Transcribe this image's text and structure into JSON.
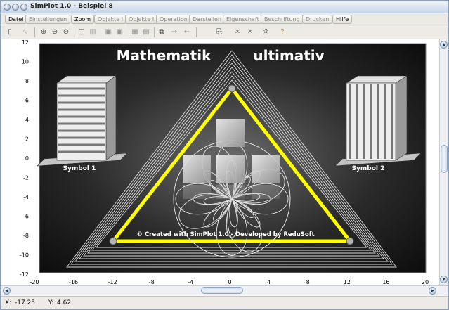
{
  "window": {
    "title": "SimPlot 1.0 - Beispiel 8"
  },
  "menu": [
    "Datei",
    "Einstellungen",
    "Zoom",
    "Objekte I",
    "Objekte II",
    "Operation",
    "Darstellen",
    "Eigenschaft",
    "Beschriftung",
    "Drucken",
    "Hilfe"
  ],
  "toolbar_icons": [
    "calculator-icon",
    "graph-icon",
    "zoom-in-icon",
    "zoom-out-icon",
    "zoom-fit-icon",
    "square-icon",
    "grid-icon",
    "box-icon",
    "box2-icon",
    "table-icon",
    "image-icon",
    "copy-icon",
    "arrow-right-icon",
    "arrow-left-icon",
    "page-icon",
    "cross-icon",
    "cross2-icon",
    "printer-icon",
    "help-icon"
  ],
  "plot": {
    "title_left": "Mathematik",
    "title_right": "ultimativ",
    "symbol1_label": "Symbol 1",
    "symbol2_label": "Symbol 2",
    "credit": "© Created with SimPlot 1.0 - Developed by ReduSoft",
    "x_ticks": [
      "-20",
      "-16",
      "-12",
      "-8",
      "-4",
      "0",
      "4",
      "8",
      "12",
      "16",
      "20"
    ],
    "y_ticks": [
      "12",
      "10",
      "8",
      "6",
      "4",
      "2",
      "0",
      "-2",
      "-4",
      "-6",
      "-8",
      "-10",
      "-12"
    ],
    "triangle_color": "#ffff00"
  },
  "status": {
    "x_label": "X:",
    "x_value": "-17.25",
    "y_label": "Y:",
    "y_value": "4.62"
  }
}
